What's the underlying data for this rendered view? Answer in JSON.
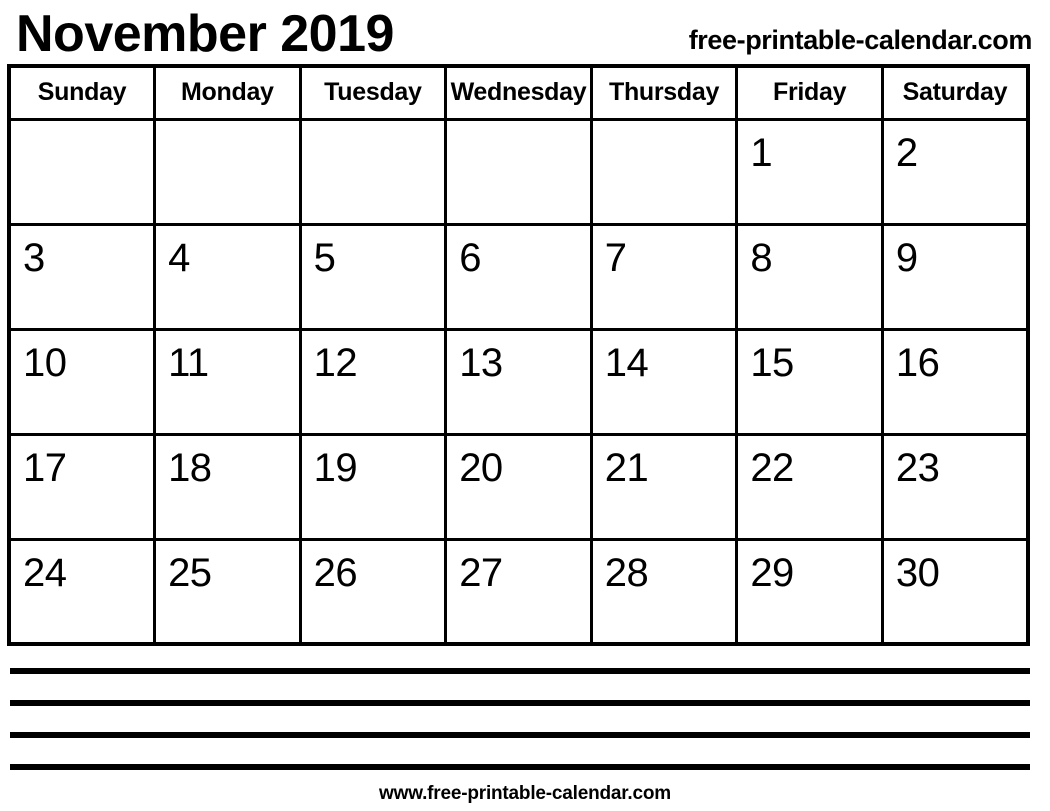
{
  "header": {
    "title": "November 2019",
    "site_url": "free-printable-calendar.com"
  },
  "calendar": {
    "month": "November",
    "year": "2019",
    "weekday_headers": [
      "Sunday",
      "Monday",
      "Tuesday",
      "Wednesday",
      "Thursday",
      "Friday",
      "Saturday"
    ],
    "weeks": [
      [
        "",
        "",
        "",
        "",
        "",
        "1",
        "2"
      ],
      [
        "3",
        "4",
        "5",
        "6",
        "7",
        "8",
        "9"
      ],
      [
        "10",
        "11",
        "12",
        "13",
        "14",
        "15",
        "16"
      ],
      [
        "17",
        "18",
        "19",
        "20",
        "21",
        "22",
        "23"
      ],
      [
        "24",
        "25",
        "26",
        "27",
        "28",
        "29",
        "30"
      ]
    ]
  },
  "notes": {
    "line_count": 4
  },
  "footer": {
    "site_url": "www.free-printable-calendar.com"
  },
  "colors": {
    "ink": "#000000",
    "paper": "#ffffff"
  }
}
